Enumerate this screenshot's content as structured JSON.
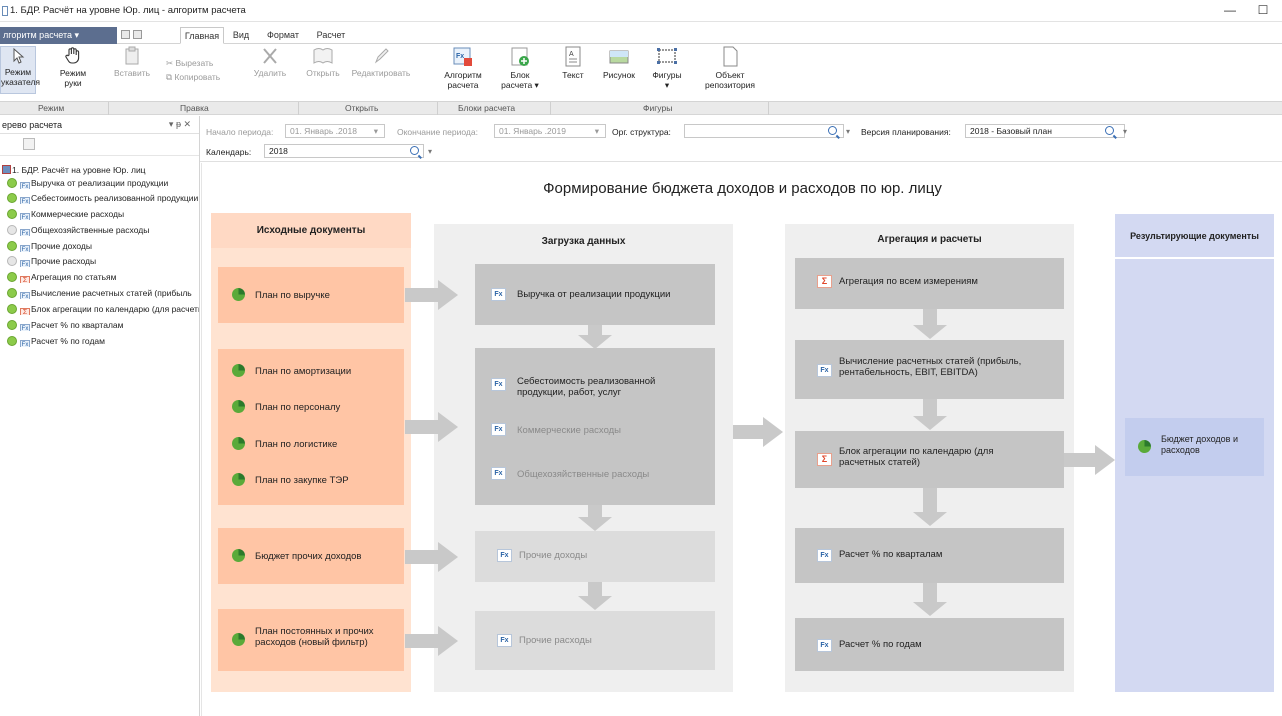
{
  "window": {
    "title": "1. БДР. Расчёт на уровне Юр. лиц - алгоритм расчета",
    "minimize": "—",
    "maximize": "☐"
  },
  "ribbon_tabs": {
    "app_menu": "лгоритм расчета",
    "tabs": [
      "Главная",
      "Вид",
      "Формат",
      "Расчет"
    ],
    "active": "Главная"
  },
  "ribbon": {
    "mode_pointer": "Режим указателя",
    "mode_hand": "Режим руки",
    "paste": "Вставить",
    "cut": "Вырезать",
    "copy": "Копировать",
    "delete": "Удалить",
    "open": "Открыть",
    "edit": "Редактировать",
    "algorithm": "Алгоритм расчета",
    "block": "Блок расчета",
    "text": "Текст",
    "picture": "Рисунок",
    "shapes": "Фигуры",
    "repo_object": "Объект репозитория",
    "groups": {
      "mode": "Режим",
      "edit": "Правка",
      "open": "Открыть",
      "blocks": "Блоки расчета",
      "shapes": "Фигуры"
    }
  },
  "tree": {
    "header": "ерево расчета",
    "header_controls": "▾ ᵽ ✕",
    "root": "1. БДР. Расчёт на уровне Юр. лиц",
    "items": [
      {
        "label": "Выручка от реализации продукции",
        "status": "green",
        "icon": "fx"
      },
      {
        "label": "Себестоимость реализованной продукции",
        "status": "green",
        "icon": "fx"
      },
      {
        "label": "Коммерческие расходы",
        "status": "green",
        "icon": "fx"
      },
      {
        "label": "Общехозяйственные расходы",
        "status": "gray",
        "icon": "fx"
      },
      {
        "label": "Прочие доходы",
        "status": "green",
        "icon": "fx"
      },
      {
        "label": "Прочие расходы",
        "status": "gray",
        "icon": "fx"
      },
      {
        "label": "Агрегация по статьям",
        "status": "green",
        "icon": "sigma"
      },
      {
        "label": "Вычисление расчетных статей (прибыль",
        "status": "green",
        "icon": "fx"
      },
      {
        "label": "Блок агрегации по календарю (для расчетных статей)",
        "status": "green",
        "icon": "sigma"
      },
      {
        "label": "Расчет % по кварталам",
        "status": "green",
        "icon": "fx"
      },
      {
        "label": "Расчет % по годам",
        "status": "green",
        "icon": "fx"
      }
    ]
  },
  "filters": {
    "period_start_label": "Начало периода:",
    "period_start_value": "01. Январь .2018",
    "period_end_label": "Окончание периода:",
    "period_end_value": "01. Январь .2019",
    "org_label": "Орг. структура:",
    "org_value": "",
    "plan_version_label": "Версия планирования:",
    "plan_version_value": "2018 - Базовый план",
    "calendar_label": "Календарь:",
    "calendar_value": "2018"
  },
  "diagram": {
    "title": "Формирование бюджета доходов и расходов по юр. лицу",
    "source": {
      "header": "Исходные документы",
      "items": [
        "План по выручке",
        "План по амортизации",
        "План по персоналу",
        "План по логистике",
        "План по закупке ТЭР",
        "Бюджет прочих  доходов",
        "План постоянных и прочих расходов (новый фильтр)"
      ]
    },
    "load": {
      "header": "Загрузка данных",
      "revenue": "Выручка от реализации продукции",
      "cost": "Себестоимость реализованной продукции, работ, услуг",
      "commercial": "Коммерческие расходы",
      "general": "Общехозяйственные расходы",
      "other_income": "Прочие доходы",
      "other_expenses": "Прочие расходы"
    },
    "agg": {
      "header": "Агрегация и расчеты",
      "all_dims": "Агрегация по всем измерениям",
      "calc_items": "Вычисление расчетных статей (прибыль, рентабельность, EBIT, EBITDA)",
      "calendar_agg": "Блок агрегации по календарю (для расчетных статей)",
      "quarters": "Расчет % по кварталам",
      "years": "Расчет % по годам"
    },
    "result": {
      "header": "Результирующие документы",
      "item": "Бюджет доходов и расходов"
    }
  }
}
